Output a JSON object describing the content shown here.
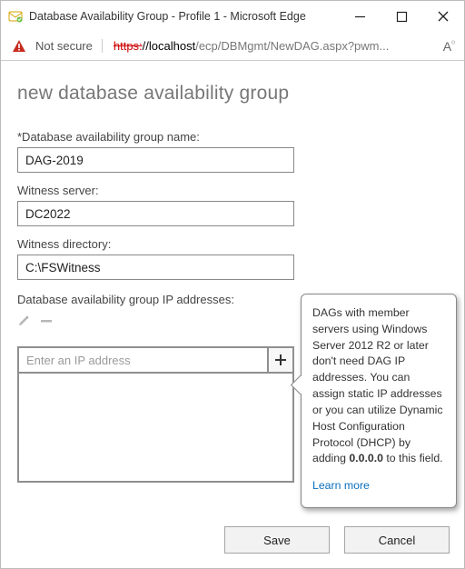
{
  "window": {
    "title": "Database Availability Group - Profile 1 - Microsoft Edge"
  },
  "address_bar": {
    "not_secure": "Not secure",
    "url_https": "https:",
    "url_host": "//localhost",
    "url_path": "/ecp/DBMgmt/NewDAG.aspx?pwm..."
  },
  "page": {
    "title": "new database availability group",
    "labels": {
      "dag_name": "*Database availability group name:",
      "witness_server": "Witness server:",
      "witness_dir": "Witness directory:",
      "ip_section": "Database availability group IP addresses:"
    },
    "values": {
      "dag_name": "DAG-2019",
      "witness_server": "DC2022",
      "witness_dir": "C:\\FSWitness"
    },
    "ip_input_placeholder": "Enter an IP address"
  },
  "tooltip": {
    "t1": "DAGs with member servers using Windows Server 2012 R2 or later don't need DAG IP addresses. You can assign static IP addresses or you can utilize Dynamic Host Configuration Protocol (DHCP) by adding ",
    "bold": "0.0.0.0",
    "t2": " to this field.",
    "link": "Learn more"
  },
  "buttons": {
    "save": "Save",
    "cancel": "Cancel"
  }
}
